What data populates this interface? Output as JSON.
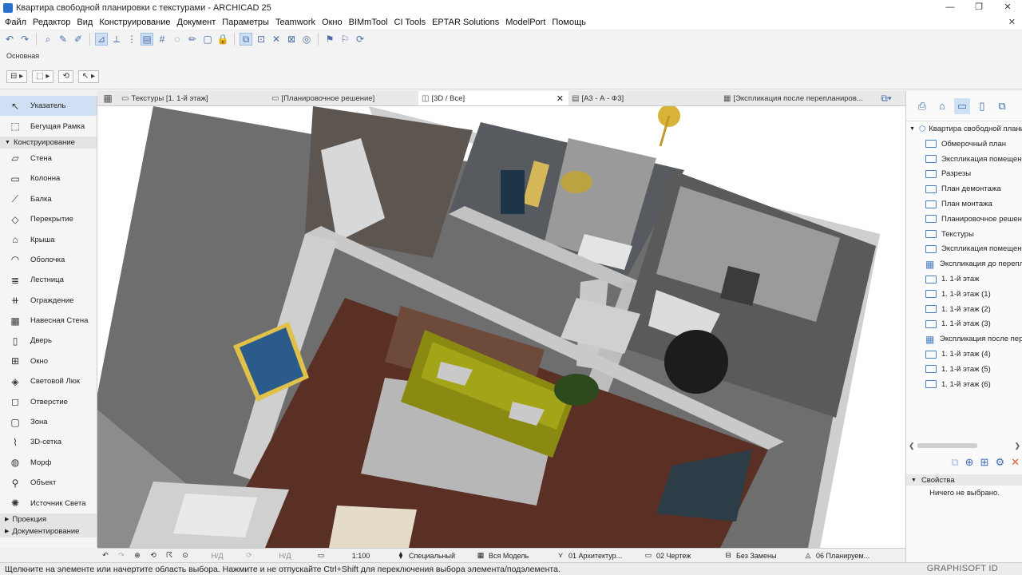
{
  "window": {
    "title": "Квартира свободной планировки с текстурами - ARCHICAD 25",
    "minimize": "—",
    "restore": "❐",
    "close": "✕"
  },
  "menu": [
    "Файл",
    "Редактор",
    "Вид",
    "Конструирование",
    "Документ",
    "Параметры",
    "Teamwork",
    "Окно",
    "BIMmTool",
    "CI Tools",
    "EPTAR Solutions",
    "ModelPort",
    "Помощь"
  ],
  "menu_close": "✕",
  "infobox": {
    "label": "Основная"
  },
  "toolbox": {
    "select_items": [
      {
        "label": "Указатель",
        "icon": "arrow-pointer-icon",
        "glyph": "↖"
      },
      {
        "label": "Бегущая Рамка",
        "icon": "marquee-icon",
        "glyph": "⬚"
      }
    ],
    "group_design": "Конструирование",
    "design_items": [
      {
        "label": "Стена",
        "icon": "wall-icon",
        "glyph": "▱"
      },
      {
        "label": "Колонна",
        "icon": "column-icon",
        "glyph": "▭"
      },
      {
        "label": "Балка",
        "icon": "beam-icon",
        "glyph": "⟋"
      },
      {
        "label": "Перекрытие",
        "icon": "slab-icon",
        "glyph": "◇"
      },
      {
        "label": "Крыша",
        "icon": "roof-icon",
        "glyph": "⌂"
      },
      {
        "label": "Оболочка",
        "icon": "shell-icon",
        "glyph": "◠"
      },
      {
        "label": "Лестница",
        "icon": "stair-icon",
        "glyph": "≣"
      },
      {
        "label": "Ограждение",
        "icon": "railing-icon",
        "glyph": "⧺"
      },
      {
        "label": "Навесная Стена",
        "icon": "curtain-wall-icon",
        "glyph": "▦"
      },
      {
        "label": "Дверь",
        "icon": "door-icon",
        "glyph": "▯"
      },
      {
        "label": "Окно",
        "icon": "window-icon",
        "glyph": "⊞"
      },
      {
        "label": "Световой Люк",
        "icon": "skylight-icon",
        "glyph": "◈"
      },
      {
        "label": "Отверстие",
        "icon": "opening-icon",
        "glyph": "◻"
      },
      {
        "label": "Зона",
        "icon": "zone-icon",
        "glyph": "▢"
      },
      {
        "label": "3D-сетка",
        "icon": "mesh-icon",
        "glyph": "⌇"
      },
      {
        "label": "Морф",
        "icon": "morph-icon",
        "glyph": "◍"
      },
      {
        "label": "Объект",
        "icon": "object-icon",
        "glyph": "⚲"
      },
      {
        "label": "Источник Света",
        "icon": "lamp-icon",
        "glyph": "✺"
      }
    ],
    "group_projection": "Проекция",
    "group_documentation": "Документирование"
  },
  "tabs": [
    {
      "label": "Текстуры [1. 1-й этаж]",
      "icon": "floorplan-icon",
      "glyph": "▭"
    },
    {
      "label": "[Планировочное решение]",
      "icon": "layout-icon",
      "glyph": "▭"
    },
    {
      "label": "[3D / Все]",
      "icon": "3d-icon",
      "glyph": "◫",
      "active": true
    },
    {
      "label": "[А3 - А - Ф3]",
      "icon": "sheet-icon",
      "glyph": "▤"
    },
    {
      "label": "[Экспликация после перепланиров...",
      "icon": "schedule-icon",
      "glyph": "▦"
    }
  ],
  "tab_close": "✕",
  "navigator": {
    "root": "Квартира свободной планировки",
    "items": [
      {
        "label": "Обмерочный план",
        "kind": "folder"
      },
      {
        "label": "Экспликация помещений",
        "kind": "folder"
      },
      {
        "label": "Разрезы",
        "kind": "folder"
      },
      {
        "label": "План демонтажа",
        "kind": "folder"
      },
      {
        "label": "План монтажа",
        "kind": "folder"
      },
      {
        "label": "Планировочное решение",
        "kind": "folder"
      },
      {
        "label": "Текстуры",
        "kind": "folder"
      },
      {
        "label": "Экспликация помещений",
        "kind": "folder"
      },
      {
        "label": "Экспликация до перепланировки",
        "kind": "grid"
      },
      {
        "label": "1. 1-й этаж",
        "kind": "folder"
      },
      {
        "label": "1. 1-й этаж (1)",
        "kind": "folder"
      },
      {
        "label": "1. 1-й этаж (2)",
        "kind": "folder"
      },
      {
        "label": "1. 1-й этаж (3)",
        "kind": "folder"
      },
      {
        "label": "Экспликация после перепланировки",
        "kind": "grid"
      },
      {
        "label": "1. 1-й этаж (4)",
        "kind": "folder"
      },
      {
        "label": "1. 1-й этаж (5)",
        "kind": "folder"
      },
      {
        "label": "1. 1-й этаж (6)",
        "kind": "folder"
      }
    ],
    "properties_label": "Свойства",
    "nothing_selected": "Ничего не выбрано."
  },
  "quick_options": {
    "nd1": "Н/Д",
    "nd2": "Н/Д",
    "scale": "1:100",
    "structure": "Специальный",
    "model": "Вся Модель",
    "layers": "01 Архитектур...",
    "pen": "02 Чертеж",
    "renovation": "Без Замены",
    "mvo": "06 Планируем..."
  },
  "status": {
    "message": "Щелкните на элементе или начертите область выбора. Нажмите и не отпускайте Ctrl+Shift для переключения выбора элемента/подэлемента.",
    "brand": "GRAPHISOFT ID"
  },
  "colors": {
    "accent": "#cfe0f5",
    "wood_floor": "#5a2f24",
    "wall_gray": "#b9b9b9",
    "sofa": "#8a8a12"
  }
}
